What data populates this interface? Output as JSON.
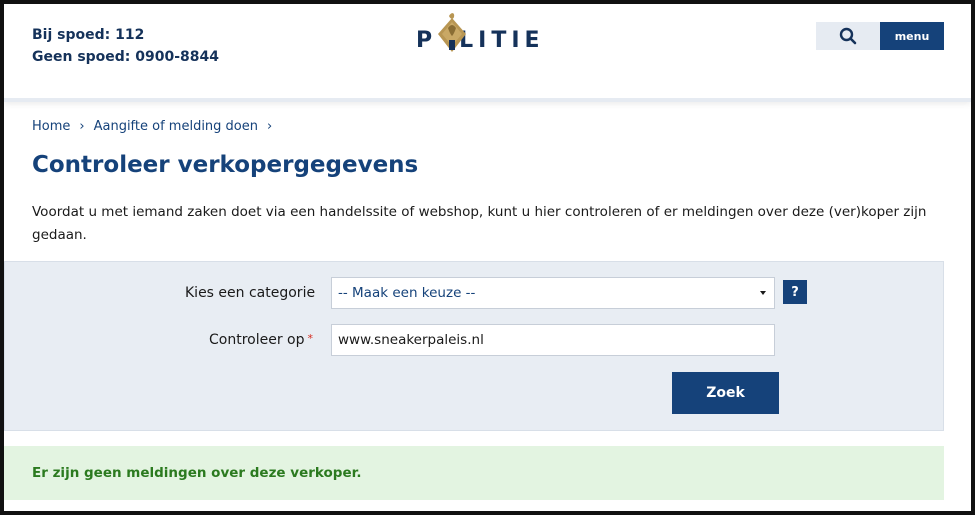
{
  "header": {
    "emergency_line1": "Bij spoed: 112",
    "emergency_line2": "Geen spoed: 0900-8844",
    "logo_text_left": "P",
    "logo_text_right": "LITIE",
    "search_icon": "search-icon",
    "menu_label": "menu"
  },
  "breadcrumb": {
    "items": [
      "Home",
      "Aangifte of melding doen"
    ],
    "separator": "›"
  },
  "page": {
    "title": "Controleer verkopergegevens",
    "intro": "Voordat u met iemand zaken doet via een handelssite of webshop, kunt u hier controleren of er meldingen over deze (ver)koper zijn gedaan."
  },
  "form": {
    "category_label": "Kies een categorie",
    "category_selected": "-- Maak een keuze --",
    "help_label": "?",
    "check_label": "Controleer op",
    "required_marker": "*",
    "check_value": "www.sneakerpaleis.nl",
    "submit_label": "Zoek"
  },
  "result": {
    "message": "Er zijn geen meldingen over deze verkoper."
  },
  "colors": {
    "brand_blue": "#15427a",
    "panel_bg": "#e8edf3",
    "success_bg": "#e3f4e1",
    "success_text": "#2b7a1f",
    "gold": "#b89653"
  }
}
